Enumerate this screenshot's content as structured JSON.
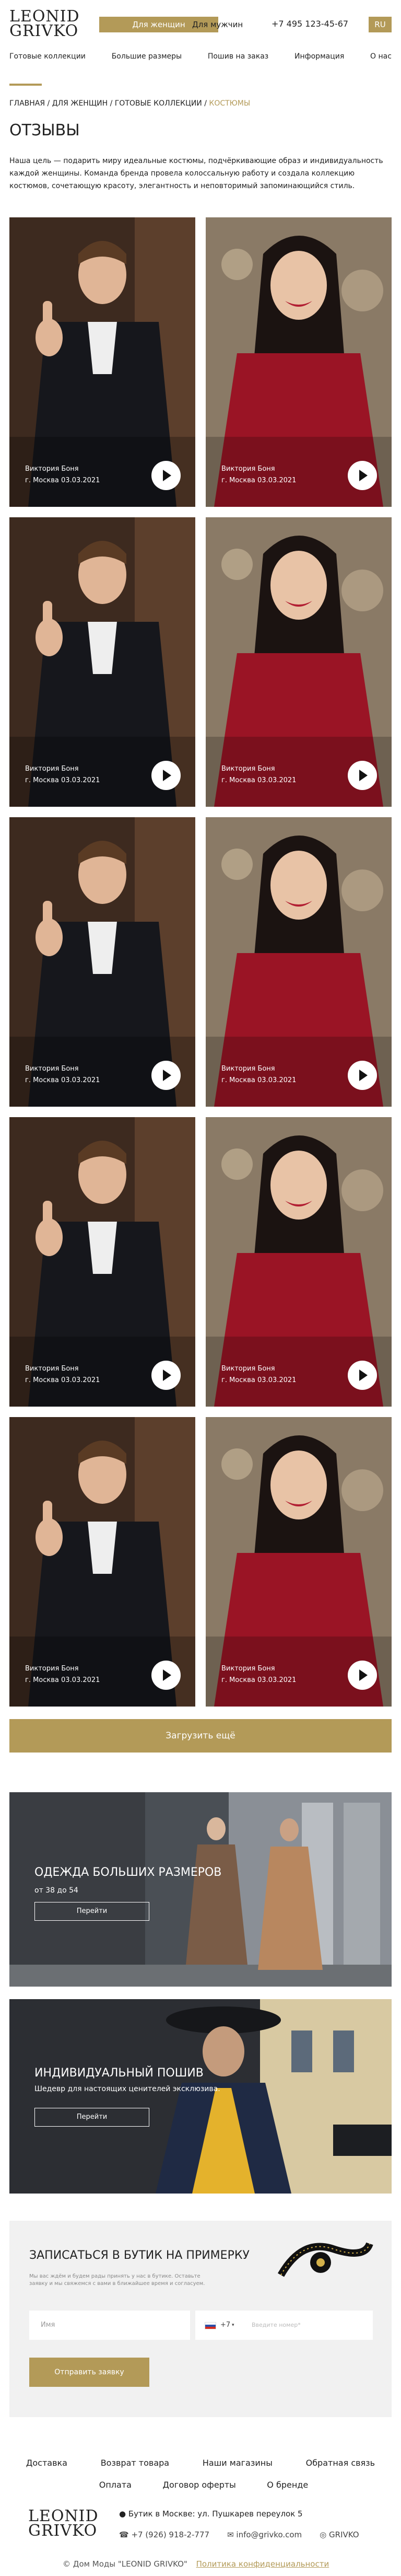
{
  "header": {
    "logo_line1": "LEONID",
    "logo_line2": "GRIVKO",
    "gender_women": "Для женщин",
    "gender_men": "Для мужчин",
    "phone": "+7 495 123-45-67",
    "lang": "RU",
    "accent_color": "#b39a58"
  },
  "nav": {
    "items": [
      "Готовые коллекции",
      "Большие размеры",
      "Пошив на заказ",
      "Информация",
      "О нас"
    ]
  },
  "breadcrumb": {
    "home": "ГЛАВНАЯ",
    "women": "ДЛЯ ЖЕНЩИН",
    "collections": "ГОТОВЫЕ КОЛЛЕКЦИИ",
    "current": "КОСТЮМЫ",
    "sep": "/"
  },
  "page": {
    "title": "ОТЗЫВЫ",
    "intro": "Наша цель — подарить миру идеальные костюмы, подчёркивающие образ и индивидуальность каждой женщины. Команда бренда провела колоссальную работу и создала коллекцию костюмов, сочетающую красоту, элегантность и неповторимый запоминающийся стиль."
  },
  "reviews": [
    {
      "name": "Виктория Боня",
      "city_date": "г. Москва 03.03.2021",
      "photo": "man-thumbs-up"
    },
    {
      "name": "Виктория Боня",
      "city_date": "г. Москва 03.03.2021",
      "photo": "woman-red-sweater"
    },
    {
      "name": "Виктория Боня",
      "city_date": "г. Москва 03.03.2021",
      "photo": "man-thumbs-up"
    },
    {
      "name": "Виктория Боня",
      "city_date": "г. Москва 03.03.2021",
      "photo": "woman-red-sweater"
    },
    {
      "name": "Виктория Боня",
      "city_date": "г. Москва 03.03.2021",
      "photo": "man-thumbs-up"
    },
    {
      "name": "Виктория Боня",
      "city_date": "г. Москва 03.03.2021",
      "photo": "woman-red-sweater"
    },
    {
      "name": "Виктория Боня",
      "city_date": "г. Москва 03.03.2021",
      "photo": "man-thumbs-up"
    },
    {
      "name": "Виктория Боня",
      "city_date": "г. Москва 03.03.2021",
      "photo": "woman-red-sweater"
    },
    {
      "name": "Виктория Боня",
      "city_date": "г. Москва 03.03.2021",
      "photo": "man-thumbs-up"
    },
    {
      "name": "Виктория Боня",
      "city_date": "г. Москва 03.03.2021",
      "photo": "woman-red-sweater"
    }
  ],
  "load_more": "Загрузить ещё",
  "banners": [
    {
      "title": "ОДЕЖДА БОЛЬШИХ РАЗМЕРОВ",
      "subtitle": "от 38 до 54",
      "button": "Перейти"
    },
    {
      "title": "ИНДИВИДУАЛЬНЫЙ ПОШИВ",
      "subtitle": "Шедевр для настоящих ценителей эксклюзива.",
      "button": "Перейти"
    }
  ],
  "form": {
    "title": "ЗАПИСАТЬСЯ В БУТИК НА ПРИМЕРКУ",
    "note": "Мы вас ждём и будем рады принять у нас в бутике. Оставьте заявку и мы свяжемся с вами в ближайшее время и согласуем.",
    "name_placeholder": "Имя",
    "phone_code": "+7",
    "phone_placeholder": "Введите номер*",
    "submit": "Отправить заявку"
  },
  "footer": {
    "links_row1": [
      "Доставка",
      "Возврат товара",
      "Наши магазины",
      "Обратная связь"
    ],
    "links_row2": [
      "Оплата",
      "Договор оферты",
      "О бренде"
    ],
    "logo_line1": "LEONID",
    "logo_line2": "GRIVKO",
    "address": "Бутик в Москве: ул. Пушкарев переулок 5",
    "phone": "+7 (926) 918-2-777",
    "email": "info@grivko.com",
    "social": "GRIVKO",
    "copyright": "© Дом Моды \"LEONID GRIVKO\"",
    "policy": "Политика конфиденциальности"
  }
}
